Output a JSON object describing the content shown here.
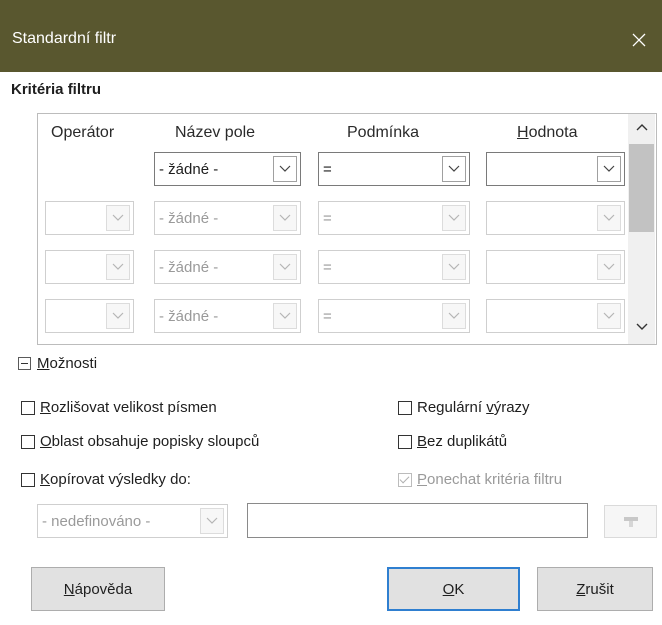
{
  "window": {
    "title": "Standardní filtr",
    "close_icon": "close-icon"
  },
  "criteria": {
    "section_title": "Kritéria filtru",
    "headers": {
      "operator": "Operátor",
      "field_name": "Název pole",
      "condition": "Podmínka",
      "value_pre": "",
      "value_mnemonic": "H",
      "value_rest": "odnota"
    },
    "rows": [
      {
        "operator": "",
        "field_name": "- žádné -",
        "condition": "=",
        "value": "",
        "enabled": true
      },
      {
        "operator": "",
        "field_name": "- žádné -",
        "condition": "=",
        "value": "",
        "enabled": false
      },
      {
        "operator": "",
        "field_name": "- žádné -",
        "condition": "=",
        "value": "",
        "enabled": false
      },
      {
        "operator": "",
        "field_name": "- žádné -",
        "condition": "=",
        "value": "",
        "enabled": false
      }
    ]
  },
  "options": {
    "expander": {
      "pre": "",
      "mnemonic": "M",
      "rest": "ožnosti",
      "expanded": true
    },
    "case_sensitive": {
      "pre": "",
      "mnemonic": "R",
      "rest": "ozlišovat velikost písmen",
      "checked": false
    },
    "regex": {
      "pre": "Regulární ",
      "mnemonic": "v",
      "rest": "ýrazy",
      "checked": false
    },
    "range_has_headers": {
      "pre": "",
      "mnemonic": "O",
      "rest": "blast obsahuje popisky sloupců",
      "checked": false
    },
    "no_duplicates": {
      "pre": "",
      "mnemonic": "B",
      "rest": "ez duplikátů",
      "checked": false
    },
    "copy_results": {
      "pre": "",
      "mnemonic": "K",
      "rest": "opírovat výsledky do:",
      "checked": false
    },
    "keep_criteria": {
      "pre": "",
      "mnemonic": "P",
      "rest": "onechat kritéria filtru",
      "checked": true,
      "enabled": false
    },
    "target_dropdown_value": "- nedefinováno -",
    "target_input_value": ""
  },
  "buttons": {
    "help": {
      "pre": "",
      "mnemonic": "N",
      "rest": "ápověda"
    },
    "ok": {
      "pre": "",
      "mnemonic": "O",
      "rest": "K"
    },
    "cancel": {
      "pre": "",
      "mnemonic": "Z",
      "rest": "rušit"
    }
  },
  "colors": {
    "titlebar": "#59572f",
    "default_button_border": "#2f7fd0"
  }
}
